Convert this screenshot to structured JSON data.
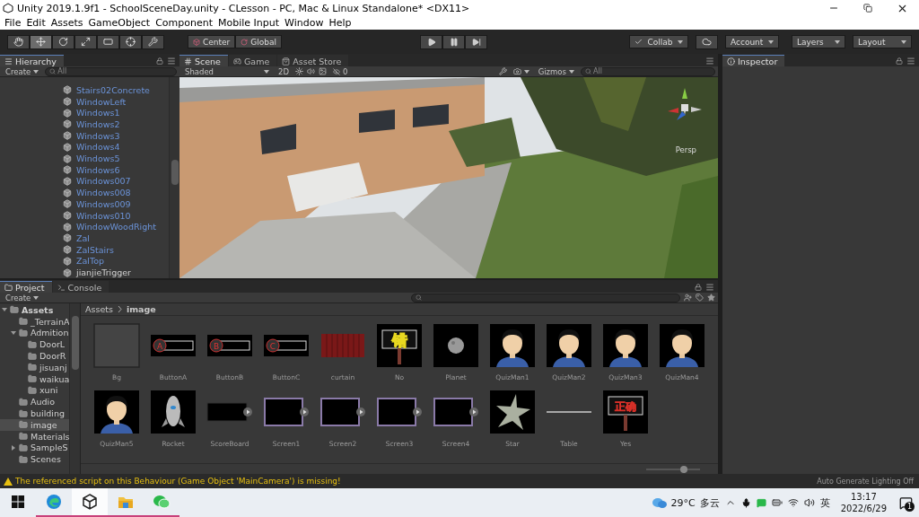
{
  "window": {
    "title": "Unity 2019.1.9f1 - SchoolSceneDay.unity - CLesson - PC, Mac & Linux Standalone* <DX11>"
  },
  "menu": [
    "File",
    "Edit",
    "Assets",
    "GameObject",
    "Component",
    "Mobile Input",
    "Window",
    "Help"
  ],
  "toolbar": {
    "tools": [
      {
        "kind": "hand",
        "selected": false
      },
      {
        "kind": "move",
        "selected": true
      },
      {
        "kind": "rotate",
        "selected": false
      },
      {
        "kind": "scale",
        "selected": false
      },
      {
        "kind": "rect",
        "selected": false
      },
      {
        "kind": "transform",
        "selected": false
      },
      {
        "kind": "custom",
        "selected": false
      }
    ],
    "pivot": "Center",
    "space": "Global",
    "collab": "Collab",
    "account": "Account",
    "layers": "Layers",
    "layout": "Layout"
  },
  "hierarchy": {
    "title": "Hierarchy",
    "create": "Create",
    "search": "All",
    "items": [
      {
        "label": "Stairs02Concrete",
        "prefab": true
      },
      {
        "label": "WindowLeft",
        "prefab": true
      },
      {
        "label": "Windows1",
        "prefab": true
      },
      {
        "label": "Windows2",
        "prefab": true
      },
      {
        "label": "Windows3",
        "prefab": true
      },
      {
        "label": "Windows4",
        "prefab": true
      },
      {
        "label": "Windows5",
        "prefab": true
      },
      {
        "label": "Windows6",
        "prefab": true
      },
      {
        "label": "Windows007",
        "prefab": true
      },
      {
        "label": "Windows008",
        "prefab": true
      },
      {
        "label": "Windows009",
        "prefab": true
      },
      {
        "label": "Windows010",
        "prefab": true
      },
      {
        "label": "WindowWoodRight",
        "prefab": true
      },
      {
        "label": "Zal",
        "prefab": true
      },
      {
        "label": "ZalStairs",
        "prefab": true
      },
      {
        "label": "ZalTop",
        "prefab": true
      },
      {
        "label": "jianjieTrigger",
        "prefab": false
      }
    ]
  },
  "scene": {
    "tabs": [
      {
        "label": "Scene",
        "kind": "scene",
        "selected": true
      },
      {
        "label": "Game",
        "kind": "game",
        "selected": false
      },
      {
        "label": "Asset Store",
        "kind": "store",
        "selected": false
      }
    ],
    "shading": "Shaded",
    "mode_2d": "2D",
    "hidden_count": "0",
    "gizmos": "Gizmos",
    "search": "All",
    "projection": "Persp"
  },
  "inspector": {
    "title": "Inspector"
  },
  "project": {
    "tabs": [
      {
        "label": "Project",
        "kind": "project",
        "selected": true
      },
      {
        "label": "Console",
        "kind": "console",
        "selected": false
      }
    ],
    "create": "Create",
    "tree": [
      {
        "label": "Assets",
        "expanded": true,
        "selected": false,
        "children": [
          {
            "label": "_TerrainA",
            "selected": false
          },
          {
            "label": "Admition",
            "expanded": true,
            "selected": false,
            "children": [
              {
                "label": "DoorL",
                "selected": false
              },
              {
                "label": "DoorR",
                "selected": false
              },
              {
                "label": "jisuanj",
                "selected": false
              },
              {
                "label": "waikua",
                "selected": false
              },
              {
                "label": "xuni",
                "selected": false
              }
            ]
          },
          {
            "label": "Audio",
            "selected": false
          },
          {
            "label": "building",
            "selected": false
          },
          {
            "label": "image",
            "selected": true
          },
          {
            "label": "Materials",
            "selected": false
          },
          {
            "label": "SampleS",
            "expanded": false,
            "selected": false
          },
          {
            "label": "Scenes",
            "selected": false
          }
        ]
      }
    ],
    "breadcrumb": [
      "Assets",
      "image"
    ],
    "thumbnail_size": {
      "level": 0.7
    },
    "assets": [
      {
        "name": "Bg",
        "kind": "blank"
      },
      {
        "name": "ButtonA",
        "kind": "button",
        "thumb_text": "A"
      },
      {
        "name": "ButtonB",
        "kind": "button",
        "thumb_text": "B"
      },
      {
        "name": "ButtonC",
        "kind": "button",
        "thumb_text": "C"
      },
      {
        "name": "curtain",
        "kind": "curtain"
      },
      {
        "name": "No",
        "kind": "sign",
        "thumb_text": "错",
        "color": "#e8d820"
      },
      {
        "name": "Planet",
        "kind": "planet"
      },
      {
        "name": "QuizMan1",
        "kind": "man"
      },
      {
        "name": "QuizMan2",
        "kind": "man"
      },
      {
        "name": "QuizMan3",
        "kind": "man"
      },
      {
        "name": "QuizMan4",
        "kind": "man"
      },
      {
        "name": "QuizMan5",
        "kind": "man"
      },
      {
        "name": "Rocket",
        "kind": "rocket"
      },
      {
        "name": "ScoreBoard",
        "kind": "scoreboard"
      },
      {
        "name": "Screen1",
        "kind": "screen"
      },
      {
        "name": "Screen2",
        "kind": "screen"
      },
      {
        "name": "Screen3",
        "kind": "screen"
      },
      {
        "name": "Screen4",
        "kind": "screen"
      },
      {
        "name": "Star",
        "kind": "star"
      },
      {
        "name": "Table",
        "kind": "line"
      },
      {
        "name": "Yes",
        "kind": "sign",
        "thumb_text": "正确",
        "color": "#d83028"
      }
    ]
  },
  "status": {
    "message": "The referenced script on this Behaviour (Game Object 'MainCamera') is missing!",
    "lighting": "Auto Generate Lighting Off"
  },
  "taskbar": {
    "apps": [
      {
        "kind": "browser",
        "selected": false,
        "running": true
      },
      {
        "kind": "unity",
        "selected": true,
        "running": true
      },
      {
        "kind": "files",
        "selected": false,
        "running": true
      },
      {
        "kind": "chat",
        "selected": false,
        "running": true
      }
    ],
    "temperature": "29°C",
    "condition": "多云",
    "ime": "英",
    "time": "13:17",
    "date": "2022/6/29",
    "notifications": "1"
  }
}
